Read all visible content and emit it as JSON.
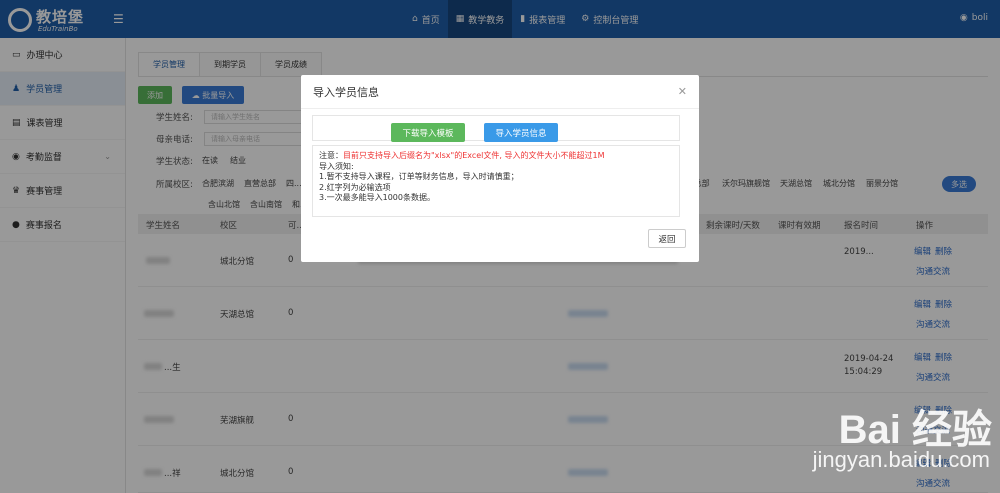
{
  "header": {
    "logo_text": "教培堡",
    "logo_sub": "EduTrainBo",
    "nav": [
      {
        "label": "首页",
        "icon": "home-icon"
      },
      {
        "label": "教学教务",
        "icon": "calendar-icon"
      },
      {
        "label": "报表管理",
        "icon": "bar-chart-icon"
      },
      {
        "label": "控制台管理",
        "icon": "gear-icon"
      }
    ],
    "user": "boli"
  },
  "sidebar": {
    "items": [
      {
        "label": "办理中心"
      },
      {
        "label": "学员管理"
      },
      {
        "label": "课表管理"
      },
      {
        "label": "考勤监督"
      },
      {
        "label": "赛事管理"
      },
      {
        "label": "赛事报名"
      }
    ]
  },
  "main": {
    "tabs": [
      "学员管理",
      "到期学员",
      "学员成绩"
    ],
    "add_label": "添加",
    "import_label": "批量导入",
    "filters": {
      "name_label": "学生姓名:",
      "name_placeholder": "请输入学生姓名",
      "phone_label": "母亲电话:",
      "phone_placeholder": "请输入母亲电话",
      "status_label": "学生状态:",
      "status_options": [
        "在读",
        "结业"
      ],
      "campus_label": "所属校区:",
      "campus_row1": [
        "合肥滨湖",
        "直营总部",
        "四..."
      ],
      "campus_row2": [
        "含山北馆",
        "含山南馆",
        "和..."
      ],
      "campus_right": [
        "...总部",
        "沃尔玛旗舰馆",
        "天湖总馆",
        "城北分馆",
        "丽景分馆"
      ],
      "more_label": "多选"
    },
    "columns": [
      "学生姓名",
      "校区",
      "可...",
      "剩余课时/天数",
      "课时有效期",
      "报名时间",
      "操作"
    ],
    "rows": [
      {
        "name": "",
        "campus": "城北分馆",
        "remaining": "0",
        "signup": "2019...",
        "actions": [
          "编辑",
          "删除",
          "沟通交流"
        ]
      },
      {
        "name": "",
        "campus": "天湖总馆",
        "remaining": "0",
        "signup": "",
        "actions": [
          "编辑",
          "删除",
          "沟通交流"
        ]
      },
      {
        "name": "...生",
        "campus": "",
        "remaining": "",
        "signup": "2019-04-24 15:04:29",
        "actions": [
          "编辑",
          "删除",
          "沟通交流"
        ]
      },
      {
        "name": "",
        "campus": "芜湖旗舰",
        "remaining": "0",
        "signup": "",
        "actions": [
          "编辑",
          "删除",
          "沟通交流"
        ]
      },
      {
        "name": "...祥",
        "campus": "城北分馆",
        "remaining": "0",
        "signup": "",
        "actions": [
          "编辑",
          "删除",
          "沟通交流"
        ]
      }
    ]
  },
  "modal": {
    "title": "导入学员信息",
    "download_label": "下载导入模板",
    "import_label": "导入学员信息",
    "notice_prefix": "注意：",
    "notice_red": "目前只支持导入后缀名为\"xlsx\"的Excel文件, 导入的文件大小不能超过1M",
    "notice_lines": [
      "导入须知:",
      "1.暂不支持导入课程，订单等财务信息，导入时请慎重；",
      "2.红字列为必输选项",
      "3.一次最多能导入1000条数据。"
    ],
    "back_label": "返回"
  },
  "watermark": {
    "big": "Bai 经验",
    "small": "jingyan.baidu.com"
  },
  "colors": {
    "primary": "#1f5ea8",
    "green": "#5cb85c",
    "blue": "#3a9ae8",
    "red": "#e33333"
  }
}
